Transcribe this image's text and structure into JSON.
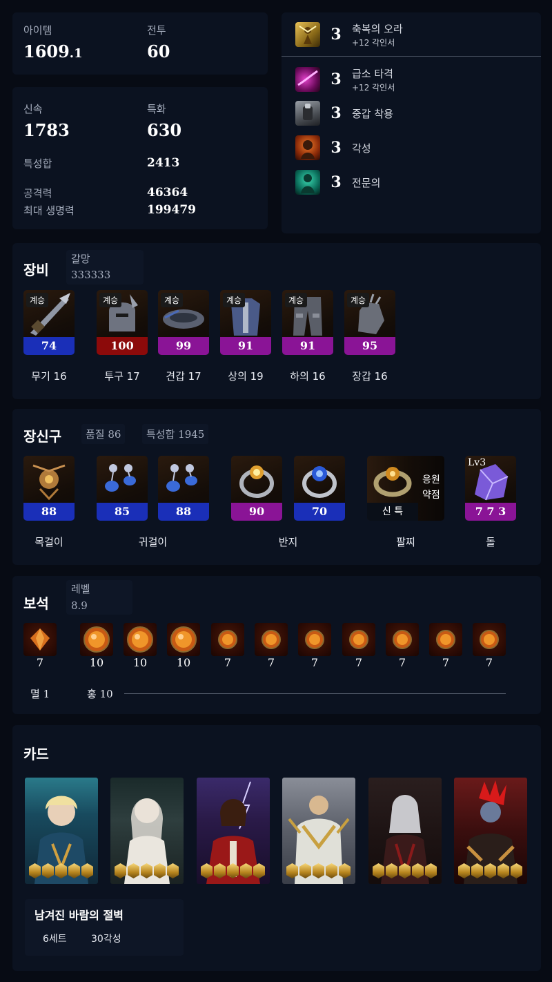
{
  "stats": {
    "item_label": "아이템",
    "item_value_main": "1609",
    "item_value_dec": ".1",
    "combat_label": "전투",
    "combat_value": "60",
    "swiftness_label": "신속",
    "swiftness_value": "1783",
    "specialization_label": "특화",
    "specialization_value": "630",
    "total_label": "특성합",
    "total_value": "2413",
    "attack_label": "공격력",
    "attack_value": "46364",
    "hp_label": "최대 생명력",
    "hp_value": "199479"
  },
  "engravings": [
    {
      "level": "3",
      "name": "축복의 오라",
      "sub": "+12 각인서"
    },
    {
      "level": "3",
      "name": "급소 타격",
      "sub": "+12 각인서"
    },
    {
      "level": "3",
      "name": "중갑 착용",
      "sub": ""
    },
    {
      "level": "3",
      "name": "각성",
      "sub": ""
    },
    {
      "level": "3",
      "name": "전문의",
      "sub": ""
    }
  ],
  "equipment": {
    "title": "장비",
    "honing_label": "갈망",
    "honing_value": "333333",
    "items": [
      {
        "tag": "계승",
        "quality": "74",
        "name": "무기 16",
        "quality_color": "#1a2fb8"
      },
      {
        "tag": "계승",
        "quality": "100",
        "name": "투구 17",
        "quality_color": "#8c0a0a"
      },
      {
        "tag": "계승",
        "quality": "99",
        "name": "견갑 17",
        "quality_color": "#8a1496"
      },
      {
        "tag": "계승",
        "quality": "91",
        "name": "상의 19",
        "quality_color": "#8a1496"
      },
      {
        "tag": "계승",
        "quality": "91",
        "name": "하의 16",
        "quality_color": "#8a1496"
      },
      {
        "tag": "계승",
        "quality": "95",
        "name": "장갑 16",
        "quality_color": "#8a1496"
      }
    ]
  },
  "accessories": {
    "title": "장신구",
    "quality_label": "품질 86",
    "total_label": "특성합 1945",
    "items": [
      {
        "quality": "88",
        "quality_color": "#1a2fb8"
      },
      {
        "quality": "85",
        "quality_color": "#1a2fb8"
      },
      {
        "quality": "88",
        "quality_color": "#1a2fb8"
      },
      {
        "quality": "90",
        "quality_color": "#8a1496"
      },
      {
        "quality": "70",
        "quality_color": "#1a2fb8"
      }
    ],
    "bracelet": {
      "stats": "신 특",
      "effect_1": "응원",
      "effect_2": "약점"
    },
    "stone": {
      "level": "Lv3",
      "value": "7 7 3"
    },
    "names": {
      "necklace": "목걸이",
      "earring": "귀걸이",
      "ring": "반지",
      "bracelet": "팔찌",
      "stone": "돌"
    }
  },
  "gems": {
    "title": "보석",
    "level_label": "레벨",
    "level_value": "8.9",
    "levels": [
      "7",
      "10",
      "10",
      "10",
      "7",
      "7",
      "7",
      "7",
      "7",
      "7",
      "7"
    ],
    "summary_1": "멸 1",
    "summary_2": "홍 10"
  },
  "cards": {
    "title": "카드",
    "set_name": "남겨진 바람의 절벽",
    "set_count": "6세트",
    "awaken_total": "30각성"
  },
  "colors": {
    "background": "#070b14",
    "panel": "#0b1220",
    "quality_blue": "#1a2fb8",
    "quality_purple": "#8a1496",
    "quality_red": "#8c0a0a"
  }
}
